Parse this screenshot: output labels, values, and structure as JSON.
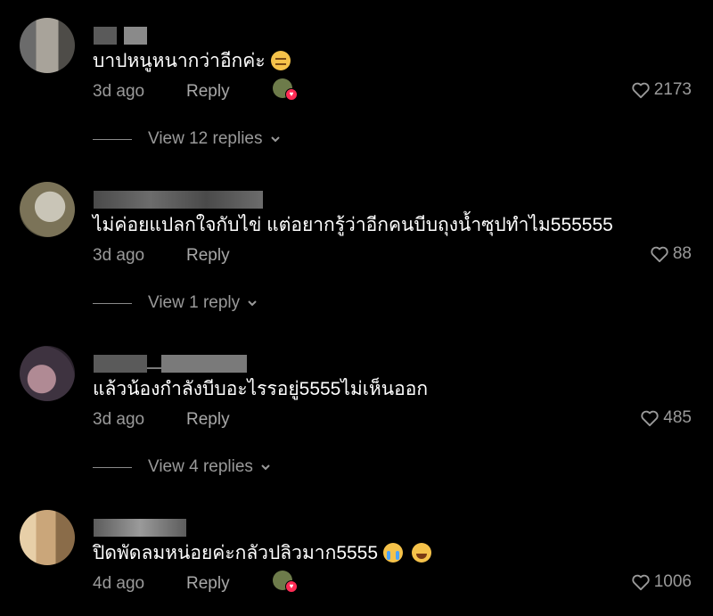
{
  "comments": [
    {
      "text": "บาปหนูหนากว่าอีกค่ะ",
      "emoji": [
        "pensive"
      ],
      "time": "3d ago",
      "reply_label": "Reply",
      "creator_liked": true,
      "likes": "2173",
      "view_replies": "View 12 replies",
      "avatar_colors": [
        "#6b6b6b",
        "#a8a39a",
        "#4e4c48"
      ],
      "username_colors": [
        "#5a5a5a",
        "#8a8a8a"
      ]
    },
    {
      "text": "ไม่ค่อยแปลกใจกับไข่ แต่อยากรู้ว่าอีกคนบีบถุงน้ำซุปทำไม555555",
      "emoji": [],
      "time": "3d ago",
      "reply_label": "Reply",
      "creator_liked": false,
      "likes": "88",
      "view_replies": "View 1 reply",
      "avatar_colors": [
        "#7b7358",
        "#c9c5b7",
        "#58543f"
      ],
      "username_colors": [
        "#4a4a4a",
        "#6c6c6c"
      ]
    },
    {
      "text": "แล้วน้องกำลังบีบอะไรรอยู่5555ไม่เห็นออก",
      "emoji": [],
      "time": "3d ago",
      "reply_label": "Reply",
      "creator_liked": false,
      "likes": "485",
      "view_replies": "View 4 replies",
      "avatar_colors": [
        "#3e3340",
        "#b08a94",
        "#2a222c"
      ],
      "username_colors": [
        "#5a5a5a",
        "#7a7a7a"
      ]
    },
    {
      "text": "ปิดพัดลมหน่อยค่ะกลัวปลิวมาก5555",
      "emoji": [
        "cry",
        "laugh"
      ],
      "time": "4d ago",
      "reply_label": "Reply",
      "creator_liked": true,
      "likes": "1006",
      "view_replies": "",
      "avatar_colors": [
        "#caa67a",
        "#8a6c49",
        "#e7cfa8"
      ],
      "username_colors": [
        "#5c5c5c",
        "#9a9a9a"
      ]
    }
  ],
  "colors": {
    "background": "#000000",
    "text": "#ffffff",
    "muted": "#9a9a9a",
    "creator_heart": "#fe2c55"
  },
  "icons": {
    "like": "heart-outline-icon",
    "expand": "chevron-down-icon",
    "creator_like": "creator-liked-avatar-icon"
  }
}
